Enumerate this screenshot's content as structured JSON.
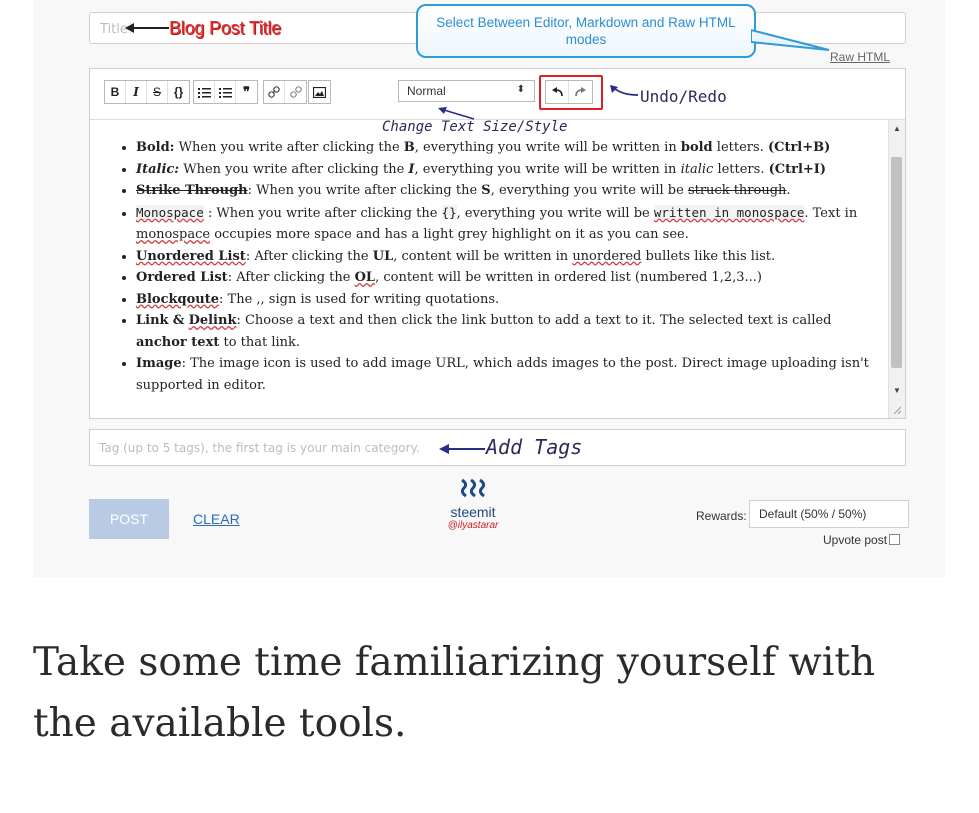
{
  "title_field": {
    "placeholder": "Title"
  },
  "annotations": {
    "blog_post_title": "Blog Post Title",
    "mode_callout": "Select Between Editor, Markdown and Raw HTML modes",
    "undo_redo": "Undo/Redo",
    "text_size_style": "Change Text Size/Style",
    "add_tags": "Add Tags"
  },
  "raw_html_link": "Raw HTML",
  "toolbar": {
    "bold": "B",
    "italic": "I",
    "strike": "S",
    "code": "{}",
    "quote": "❞",
    "format_select": "Normal"
  },
  "content": {
    "items": [
      {
        "label": "Bold:",
        "text": "When you write after clicking the"
      },
      {
        "label": "Italic:",
        "text": "When you write after clicking the"
      },
      {
        "label": "Strike Through",
        "text": "When you write after clicking the"
      },
      {
        "label": "Monospace",
        "text": "When you write after clicking the"
      },
      {
        "label": "Unordered List",
        "text": "After clicking the"
      },
      {
        "label": "Ordered List",
        "text": "After clicking the"
      },
      {
        "label": "Blockqoute",
        "text": "The ,, sign is used for writing quotations."
      },
      {
        "label": "Link",
        "text": "Choose a text and then click the link button to add a text to it. The selected text is called"
      },
      {
        "label": "Image",
        "text": "The image icon is used to add image URL, which adds images to the post. Direct image uploading isn't supported in editor."
      }
    ],
    "b_key": "B",
    "i_key": "I",
    "s_key": "S",
    "mono_key": "{}",
    "ul_key": "UL",
    "ol_key": "OL",
    "bold_word": "bold",
    "italic_word": "italic",
    "struck": "struck through",
    "mono_phrase": "written in monospace",
    "ctrl_b": "(Ctrl+B)",
    "ctrl_i": "(Ctrl+I)",
    "unordered": "unordered",
    "delink": "Delink",
    "anchor": "anchor text",
    "t_bold_tail": ", everything you write will be written in",
    "t_bold_end": "letters.",
    "t_strike_tail": ", everything you write will be",
    "t_mono_tail": ", everything you write will be",
    "t_mono_second": "Text in",
    "t_mono_second_word": "monospace",
    "t_mono_second_tail": "occupies more space and has a light grey highlight on it as you can see.",
    "t_ul_tail": ", content will be written in",
    "t_ul_end": "bullets like this list.",
    "t_ol_tail": ", content will be written in ordered list (numbered 1,2,3...)",
    "t_link_amp": "&",
    "t_link_end": "to that link."
  },
  "tags_field": {
    "placeholder": "Tag (up to 5 tags), the first tag is your main category."
  },
  "post_button": "POST",
  "clear_link": "CLEAR",
  "logo": {
    "wordmark": "steemit",
    "user": "@ilyastarar"
  },
  "rewards": {
    "label": "Rewards:",
    "selected": "Default (50% / 50%)"
  },
  "upvote_label": "Upvote post",
  "caption": "Take some time familiarizing yourself with the available tools."
}
